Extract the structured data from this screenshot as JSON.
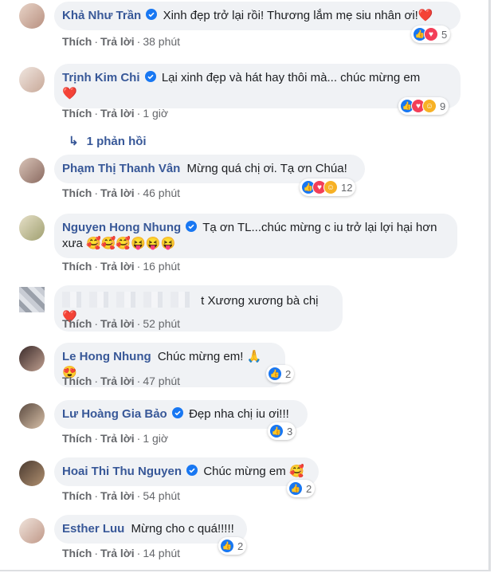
{
  "actions": {
    "like": "Thích",
    "reply": "Trả lời",
    "sep": "·"
  },
  "reply_count_link": "1 phản hồi",
  "comments": [
    {
      "name": "Khả Như Trần",
      "text": "Xinh đẹp trở lại rồi! Thương lắm mẹ siu nhân ơi!",
      "emoji": "❤️",
      "time": "38 phút",
      "reaction_count": "5"
    },
    {
      "name": "Trịnh Kim Chi",
      "text": "Lại xinh đẹp và hát hay thôi mà... chúc mừng em",
      "emoji": "❤️",
      "time": "1 giờ",
      "reaction_count": "9"
    },
    {
      "name": "Phạm Thị Thanh Vân",
      "text": "Mừng quá chị ơi. Tạ ơn Chúa!",
      "time": "46 phút",
      "reaction_count": "12"
    },
    {
      "name": "Nguyen Hong Nhung",
      "text": "Tạ ơn TL...chúc mừng c iu trở lại lợi hại hơn xưa",
      "emoji": "🥰🥰🥰😝😝😝",
      "time": "16 phút"
    },
    {
      "name": "",
      "text": "t Xương xương bà chị",
      "emoji": "❤️",
      "time": "52 phút"
    },
    {
      "name": "Le Hong Nhung",
      "text": "Chúc mừng em!",
      "emoji": "🙏😍",
      "time": "47 phút",
      "reaction_count": "2"
    },
    {
      "name": "Lư Hoàng Gia Bảo",
      "text": "Đẹp nha chị iu ơi!!!",
      "time": "1 giờ",
      "reaction_count": "3"
    },
    {
      "name": "Hoai Thi Thu Nguyen",
      "text": "Chúc mừng em",
      "emoji": "🥰",
      "time": "54 phút",
      "reaction_count": "2"
    },
    {
      "name": "Esther Luu",
      "text": "Mừng cho c quá!!!!!",
      "time": "14 phút",
      "reaction_count": "2"
    }
  ]
}
